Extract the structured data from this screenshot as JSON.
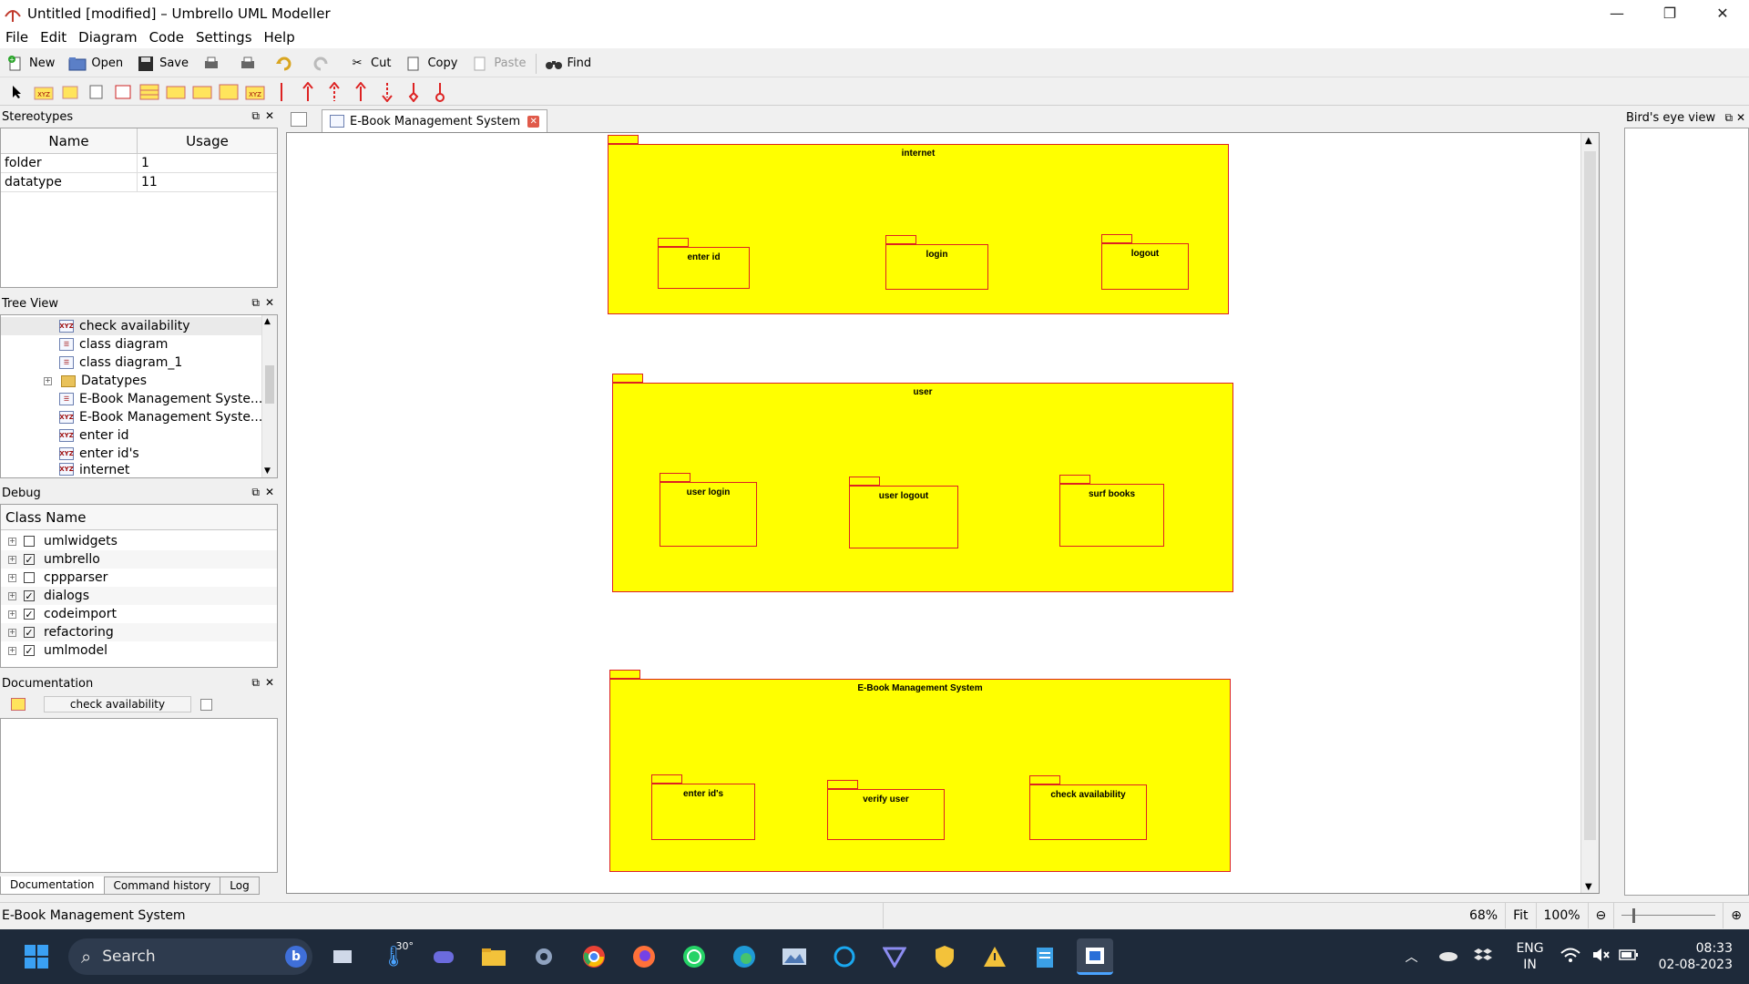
{
  "window": {
    "title": "Untitled [modified] – Umbrello UML Modeller",
    "minimize": "—",
    "maximize": "❐",
    "close": "✕"
  },
  "menu": [
    "File",
    "Edit",
    "Diagram",
    "Code",
    "Settings",
    "Help"
  ],
  "toolbar": {
    "new": "New",
    "open": "Open",
    "save": "Save",
    "cut": "Cut",
    "copy": "Copy",
    "paste": "Paste",
    "find": "Find"
  },
  "stereotypes": {
    "title": "Stereotypes",
    "col_name": "Name",
    "col_usage": "Usage",
    "rows": [
      {
        "name": "folder",
        "usage": "1"
      },
      {
        "name": "datatype",
        "usage": "11"
      }
    ]
  },
  "tree": {
    "title": "Tree View",
    "items": [
      {
        "label": "check availability",
        "icon": "diagram-icon"
      },
      {
        "label": "class diagram",
        "icon": "diagram-icon"
      },
      {
        "label": "class diagram_1",
        "icon": "diagram-icon"
      },
      {
        "label": "Datatypes",
        "icon": "folder-icon"
      },
      {
        "label": "E-Book Management Syste...",
        "icon": "diagram-icon"
      },
      {
        "label": "E-Book Management Syste...",
        "icon": "package-icon"
      },
      {
        "label": "enter id",
        "icon": "package-icon"
      },
      {
        "label": "enter id's",
        "icon": "package-icon"
      },
      {
        "label": "internet",
        "icon": "package-icon"
      }
    ]
  },
  "debug": {
    "title": "Debug",
    "col": "Class Name",
    "rows": [
      {
        "label": "umlwidgets",
        "checked": ""
      },
      {
        "label": "umbrello",
        "checked": "✓"
      },
      {
        "label": "cppparser",
        "checked": ""
      },
      {
        "label": "dialogs",
        "checked": "✓"
      },
      {
        "label": "codeimport",
        "checked": "✓"
      },
      {
        "label": "refactoring",
        "checked": "✓"
      },
      {
        "label": "umlmodel",
        "checked": "✓"
      }
    ]
  },
  "documentation": {
    "title": "Documentation",
    "field": "check availability"
  },
  "bottom_tabs": [
    "Documentation",
    "Command history",
    "Log"
  ],
  "doc_tab": "E-Book Management System",
  "diagram": {
    "packages": [
      {
        "label": "internet",
        "children": [
          "enter id",
          "login",
          "logout"
        ]
      },
      {
        "label": "user",
        "children": [
          "user login",
          "user logout",
          "surf books"
        ]
      },
      {
        "label": "E-Book Management System",
        "children": [
          "enter id's",
          "verify user",
          "check availability"
        ]
      }
    ]
  },
  "birds_eye": "Bird's eye view",
  "status": {
    "text": "E-Book Management System",
    "zoom": "68%",
    "fit": "Fit",
    "full": "100%"
  },
  "taskbar": {
    "search": "Search",
    "weather": "30°",
    "lang1": "ENG",
    "lang2": "IN",
    "time": "08:33",
    "date": "02-08-2023"
  },
  "colors": {
    "package_fill": "#ffff00",
    "package_border": "#dd2222",
    "taskbar": "#1e2a3a"
  }
}
